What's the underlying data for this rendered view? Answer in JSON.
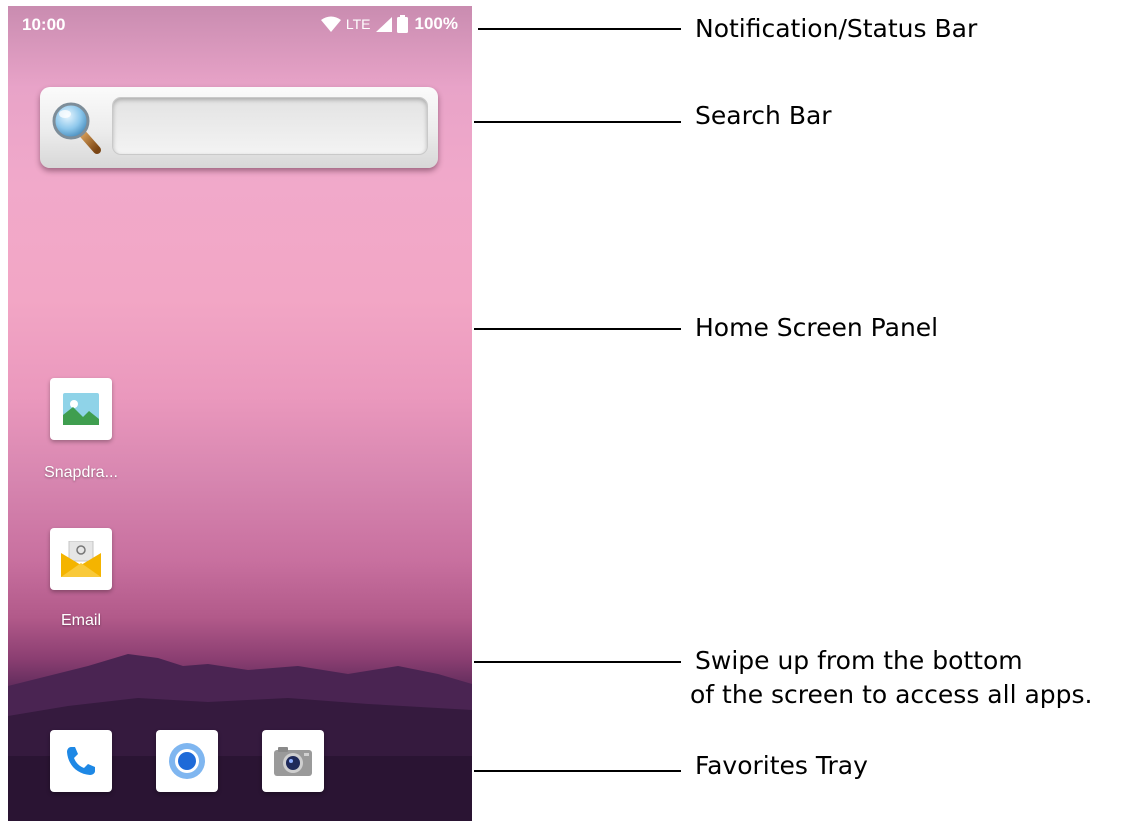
{
  "status_bar": {
    "time": "10:00",
    "network": "LTE",
    "battery": "100%"
  },
  "home": {
    "apps": [
      {
        "label": "Snapdra..."
      },
      {
        "label": "Email"
      }
    ]
  },
  "favorites": [
    "phone-icon",
    "chrome-icon",
    "camera-icon"
  ],
  "callouts": {
    "status_bar": "Notification/Status Bar",
    "search_bar": "Search Bar",
    "home_panel": "Home Screen Panel",
    "swipe_line1": "Swipe up from the bottom",
    "swipe_line2": "of the screen to access all apps.",
    "favorites_tray": "Favorites Tray"
  }
}
